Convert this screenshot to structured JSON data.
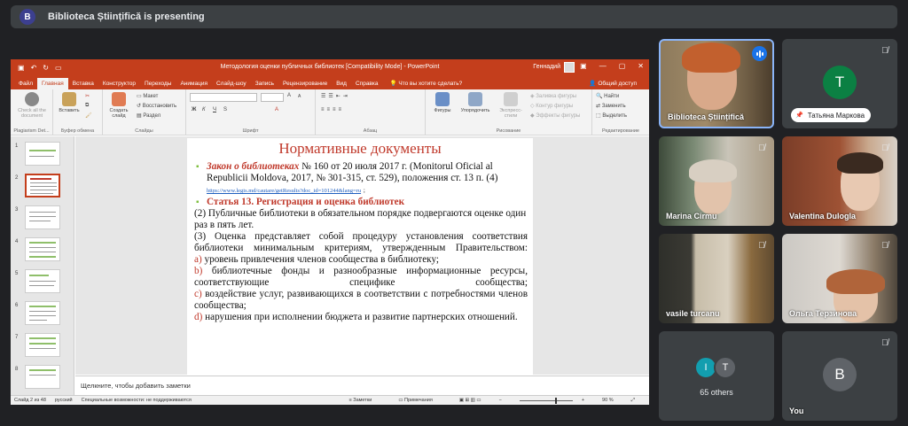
{
  "banner": {
    "avatar_letter": "B",
    "text": "Biblioteca Științifică is presenting"
  },
  "powerpoint": {
    "doc_title": "Методология оценки публичных библиотек [Compatibility Mode] - PowerPoint",
    "user": "Геннадий",
    "tabs": [
      "Файл",
      "Главная",
      "Вставка",
      "Конструктор",
      "Переходы",
      "Анимация",
      "Слайд-шоу",
      "Запись",
      "Рецензирование",
      "Вид",
      "Справка"
    ],
    "active_tab": "Главная",
    "tell_me": "Что вы хотите сделать?",
    "share": "Общий доступ",
    "ribbon": {
      "plagiarism_check": "Check all the document",
      "plagiarism_group": "Plagiarism Det...",
      "paste": "Вставить",
      "clipboard_group": "Буфер обмена",
      "new_slide": "Создать слайд",
      "layout": "Макет",
      "reset": "Восстановить",
      "section": "Раздел",
      "slides_group": "Слайды",
      "font_group": "Шрифт",
      "paragraph_group": "Абзац",
      "shapes": "Фигуры",
      "arrange": "Упорядочить",
      "quick_styles": "Экспресс-стили",
      "shape_fill": "Заливка фигуры",
      "shape_outline": "Контур фигуры",
      "shape_effects": "Эффекты фигуры",
      "drawing_group": "Рисование",
      "find": "Найти",
      "replace": "Заменить",
      "select": "Выделить",
      "editing_group": "Редактирование",
      "bold": "Ж",
      "italic": "К",
      "underline": "Ч",
      "strike": "S",
      "font_grow": "A",
      "font_shrink": "A"
    },
    "thumbnails": [
      "1",
      "2",
      "3",
      "4",
      "5",
      "6",
      "7",
      "8"
    ],
    "selected_slide": 2,
    "slide": {
      "title": "Нормативные документы",
      "law_title": "Закон о библиотеках",
      "law_text": " № 160 от 20 июля 2017 г. (Monitorul Oficial al Republicii Moldova, 2017, № 301-315, ст. 529), положения ст. 13 п. (4) ",
      "link": "https://www.legis.md/cautare/getResults?doc_id=101244&lang=ru",
      "link_tail": ";",
      "article": "Статья 13. Регистрация и оценка библиотек",
      "p2": "(2) Публичные библиотеки в обязательном порядке подвергаются оценке один раз в пять лет.",
      "p3": "(3) Оценка представляет собой процедуру установления соответствия библиотеки минимальным критериям, утвержденным Правительством:",
      "items": [
        {
          "letter": "a)",
          "text": "уровень привлечения членов сообщества в библиотеку;"
        },
        {
          "letter": "b)",
          "text": "библиотечные фонды и разнообразные информационные ресурсы, соответствующие специфике сообщества;"
        },
        {
          "letter": "c)",
          "text": "воздействие услуг, развивающихся в соответствии с потребностями членов сообщества;"
        },
        {
          "letter": "d)",
          "text": "нарушения при исполнении бюджета и развитие партнерских отношений."
        }
      ]
    },
    "notes_placeholder": "Щелкните, чтобы добавить заметки",
    "status": {
      "slide_of": "Слайд 2 из 48",
      "language": "русский",
      "accessibility": "Специальные возможности: не поддерживаются",
      "notes": "Заметки",
      "comments": "Примечания",
      "zoom": "90 %"
    }
  },
  "participants": [
    {
      "name": "Biblioteca Științifică",
      "speaking": true
    },
    {
      "name": "Татьяна Маркова",
      "letter": "T",
      "color": "#0b8043"
    },
    {
      "name": "Marina Cirmu"
    },
    {
      "name": "Valentina Dulogla"
    },
    {
      "name": "vasile turcanu"
    },
    {
      "name": "Ольга Терзинова"
    },
    {
      "name": "65 others",
      "letters": [
        "I",
        "T"
      ],
      "colors": [
        "#129eaf",
        "#5f6368"
      ]
    },
    {
      "name": "You",
      "letter": "B",
      "color": "#5f6368"
    }
  ]
}
